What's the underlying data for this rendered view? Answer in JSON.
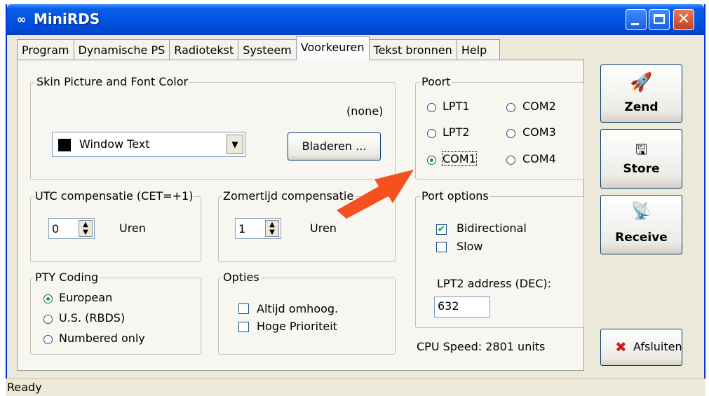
{
  "window": {
    "title": "MiniRDS",
    "app_icon": "∞",
    "close_glyph": "✕"
  },
  "tabs": [
    {
      "label": "Program"
    },
    {
      "label": "Dynamische PS"
    },
    {
      "label": "Radiotekst"
    },
    {
      "label": "Systeem"
    },
    {
      "label": "Voorkeuren",
      "active": true
    },
    {
      "label": "Tekst bronnen"
    },
    {
      "label": "Help"
    }
  ],
  "skin": {
    "legend": "Skin Picture and Font Color",
    "picture_value": "(none)",
    "color_select": "Window Text",
    "browse_button": "Bladeren ..."
  },
  "utc": {
    "legend": "UTC compensatie (CET=+1)",
    "value": "0",
    "unit": "Uren"
  },
  "dst": {
    "legend": "Zomertijd compensatie",
    "value": "1",
    "unit": "Uren"
  },
  "pty": {
    "legend": "PTY Coding",
    "options": [
      "European",
      "U.S. (RBDS)",
      "Numbered only"
    ],
    "selected": "European"
  },
  "opties": {
    "legend": "Opties",
    "options": [
      {
        "label": "Altijd omhoog.",
        "checked": false
      },
      {
        "label": "Hoge Prioriteit",
        "checked": false
      }
    ]
  },
  "poort": {
    "legend": "Poort",
    "options": [
      "LPT1",
      "COM2",
      "LPT2",
      "COM3",
      "COM1",
      "COM4"
    ],
    "selected": "COM1"
  },
  "port_options": {
    "legend": "Port options",
    "bidirectional": {
      "label": "Bidirectional",
      "checked": true
    },
    "slow": {
      "label": "Slow",
      "checked": false
    },
    "address_label": "LPT2 address (DEC):",
    "address_value": "632"
  },
  "cpu_speed": "CPU Speed: 2801 units",
  "side_buttons": {
    "send": "Zend",
    "store": "Store",
    "receive": "Receive",
    "exit": "Afsluiten",
    "exit_glyph": "✖"
  },
  "status": "Ready",
  "colors": {
    "titlebar": "#0054e3",
    "arrow": "#f4511e",
    "checkmark": "#21a121"
  }
}
